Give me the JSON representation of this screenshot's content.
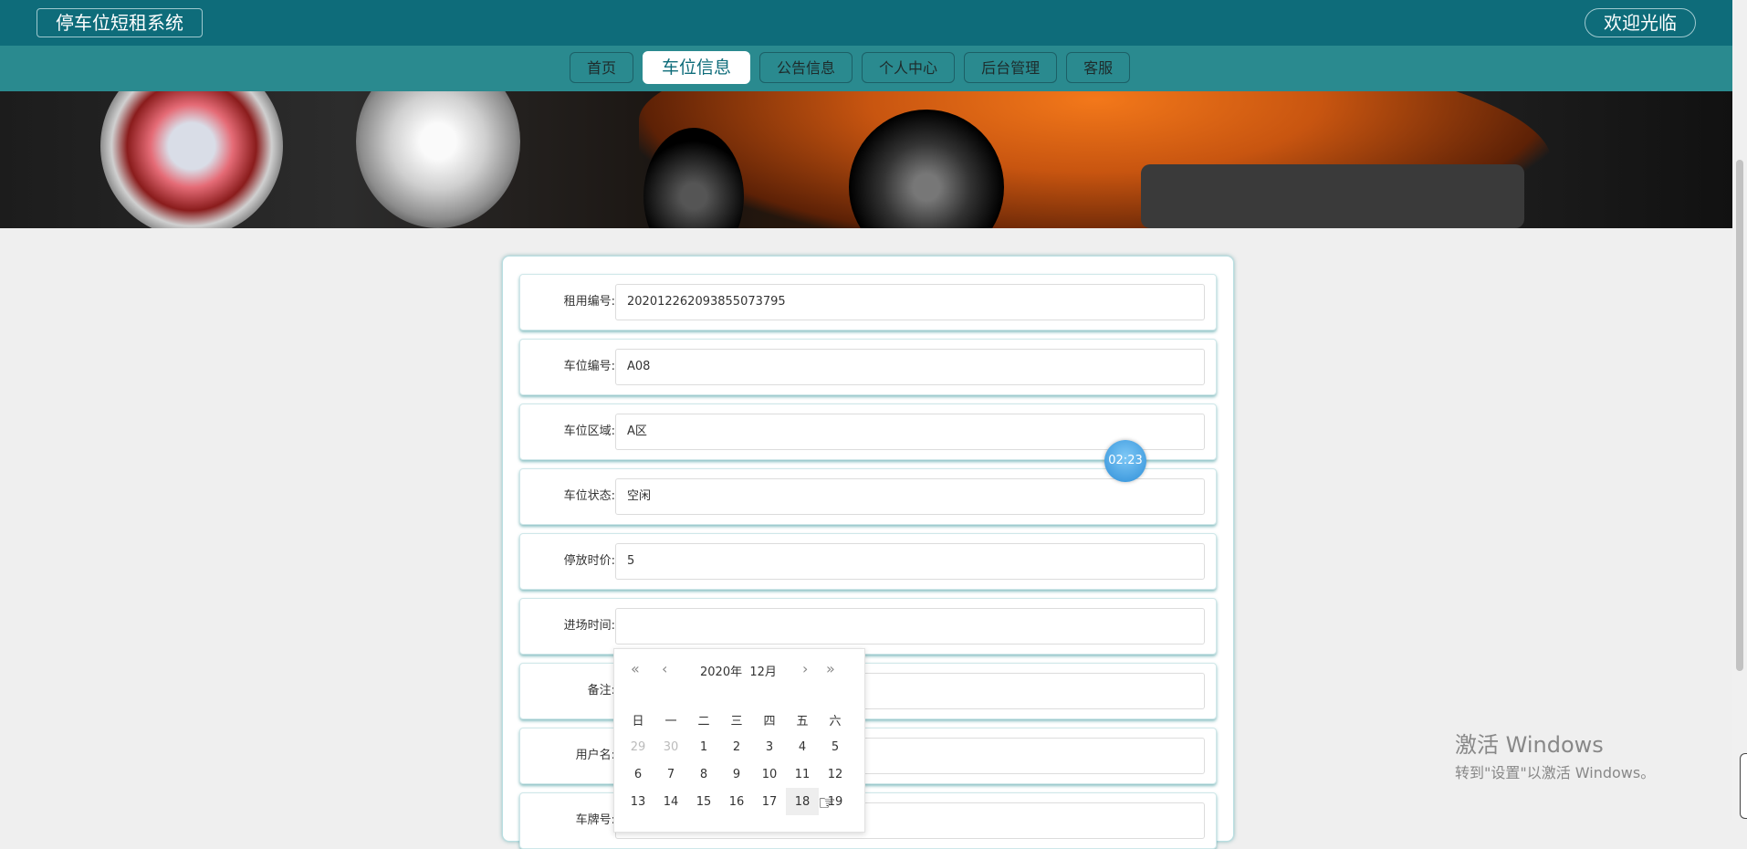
{
  "header": {
    "brand": "停车位短租系统",
    "welcome": "欢迎光临"
  },
  "nav": {
    "items": [
      {
        "label": "首页",
        "active": false
      },
      {
        "label": "车位信息",
        "active": true
      },
      {
        "label": "公告信息",
        "active": false
      },
      {
        "label": "个人中心",
        "active": false
      },
      {
        "label": "后台管理",
        "active": false
      },
      {
        "label": "客服",
        "active": false
      }
    ]
  },
  "form": {
    "rows": [
      {
        "label": "租用编号:",
        "value": "202012262093855073795"
      },
      {
        "label": "车位编号:",
        "value": "A08"
      },
      {
        "label": "车位区域:",
        "value": "A区"
      },
      {
        "label": "车位状态:",
        "value": "空闲"
      },
      {
        "label": "停放时价:",
        "value": "5"
      },
      {
        "label": "进场时间:",
        "value": ""
      },
      {
        "label": "备注:",
        "value": ""
      },
      {
        "label": "用户名:",
        "value": ""
      },
      {
        "label": "车牌号:",
        "value": ""
      }
    ]
  },
  "timer": "02:23",
  "datepicker": {
    "year": "2020年",
    "month": "12月",
    "weekdays": [
      "日",
      "一",
      "二",
      "三",
      "四",
      "五",
      "六"
    ],
    "weeks": [
      [
        "29",
        "30",
        "1",
        "2",
        "3",
        "4",
        "5"
      ],
      [
        "6",
        "7",
        "8",
        "9",
        "10",
        "11",
        "12"
      ],
      [
        "13",
        "14",
        "15",
        "16",
        "17",
        "18",
        "19"
      ]
    ],
    "hovered_day": "18"
  },
  "watermark": {
    "line1": "激活 Windows",
    "line2": "转到\"设置\"以激活 Windows。"
  },
  "colors": {
    "topbar": "#0e6c7a",
    "navbar": "#2a8a8f",
    "accent": "#0e8f7e"
  }
}
